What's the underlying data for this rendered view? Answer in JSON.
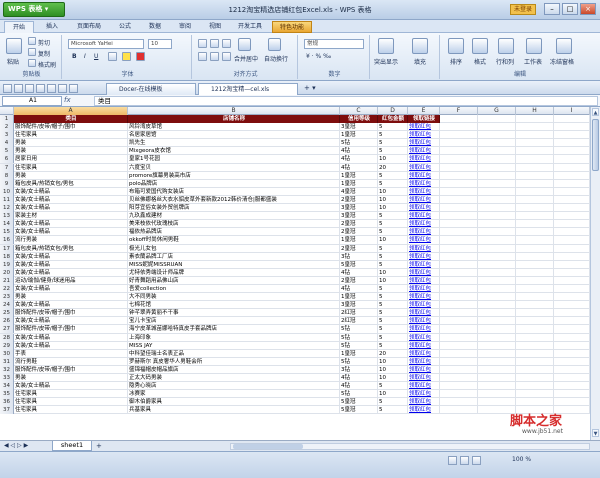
{
  "app": {
    "brand": "WPS 表格",
    "window_title": "1212淘宝精选店铺红包Excel.xls - WPS 表格",
    "unregistered": "未登录"
  },
  "menu_tabs": [
    "开始",
    "插入",
    "页面布局",
    "公式",
    "数据",
    "审阅",
    "视图",
    "开发工具",
    "特色功能"
  ],
  "ribbon": {
    "paste": "粘贴",
    "cut": "剪切",
    "copy": "复制",
    "format_painter": "格式刷",
    "group_clipboard": "剪贴板",
    "font_name": "Microsoft YaHei",
    "font_size": "10",
    "group_font": "字体",
    "merge": "合并居中",
    "wrap": "自动换行",
    "group_align": "对齐方式",
    "number_format": "常规",
    "group_number": "数字",
    "cond_format": "突出显示",
    "fill": "填充",
    "sort": "排序",
    "format": "格式",
    "row_col": "行和列",
    "worksheet": "工作表",
    "freeze": "冻结窗格",
    "group_edit": "编辑"
  },
  "doc_tabs": [
    "Docer-在线模板",
    "1212淘宝精—cel.xls"
  ],
  "formula_bar": {
    "cell_ref": "A1",
    "fx": "fx",
    "content": "类目"
  },
  "columns": [
    "A",
    "B",
    "C",
    "D",
    "E",
    "F",
    "G",
    "H",
    "I"
  ],
  "table_header": [
    "类目",
    "店铺名称",
    "信用等级",
    "红包金额",
    "领取链接"
  ],
  "rows": [
    [
      "服饰配件/皮带/帽子/围巾",
      "风铃湾皮草馆",
      "3皇冠",
      "5",
      "领取红包"
    ],
    [
      "住宅家具",
      "名居家居馆",
      "1皇冠",
      "5",
      "领取红包"
    ],
    [
      "男装",
      "凯先生",
      "5钻",
      "5",
      "领取红包"
    ],
    [
      "男装",
      "Mixgeora皮衣馆",
      "4钻",
      "5",
      "领取红包"
    ],
    [
      "居家日用",
      "皇家1号花园",
      "4钻",
      "10",
      "领取红包"
    ],
    [
      "住宅家具",
      "六度宝贝",
      "4钻",
      "20",
      "领取红包"
    ],
    [
      "男装",
      "promore旗幕男装高市店",
      "1皇冠",
      "5",
      "领取红包"
    ],
    [
      "箱包皮具/热销女包/男包",
      "polo品牌店",
      "1皇冠",
      "5",
      "领取红包"
    ],
    [
      "女装/女士精品",
      "布箱可爱国代购女装店",
      "4皇冠",
      "10",
      "领取红包"
    ],
    [
      "女装/女士精品",
      "贝丝佛娜格丝大衣水貂皮草外套新款2012韩价清仓|服都盛装",
      "2皇冠",
      "10",
      "领取红包"
    ],
    [
      "女装/女士精品",
      "阳芽宜俗女装外贸创牌店",
      "3皇冠",
      "10",
      "领取红包"
    ],
    [
      "家装主材",
      "九玖鑫成建材",
      "3皇冠",
      "5",
      "领取红包"
    ],
    [
      "女装/女士精品",
      "美来枝依代玫瑰枝店",
      "2皇冠",
      "5",
      "领取红包"
    ],
    [
      "女装/女士精品",
      "福依热品牌店",
      "2皇冠",
      "5",
      "领取红包"
    ],
    [
      "流行男装",
      "okkoff时尚休闲男鞋",
      "1皇冠",
      "10",
      "领取红包"
    ],
    [
      "箱包皮具/热销女包/男包",
      "极光儿女包",
      "2皇冠",
      "5",
      "领取红包"
    ],
    [
      "女装/女士精品",
      "素衣蘭品牌工厂店",
      "3钻",
      "5",
      "领取红包"
    ],
    [
      "女装/女士精品",
      "MISS妮妮MISSRUAN",
      "5皇冠",
      "5",
      "领取红包"
    ],
    [
      "女装/女士精品",
      "尤特依秀端设计师品牌",
      "4钻",
      "10",
      "领取红包"
    ],
    [
      "运动/瑜伽/健身/球迷用品",
      "好青舞蹈用品佛山店",
      "2皇冠",
      "10",
      "领取红包"
    ],
    [
      "女装/女士精品",
      "吾爱collection",
      "4钻",
      "5",
      "领取红包"
    ],
    [
      "男装",
      "大不同男装",
      "1皇冠",
      "5",
      "领取红包"
    ],
    [
      "女装/女士精品",
      "七棉花馆",
      "3皇冠",
      "5",
      "领取红包"
    ],
    [
      "服饰配件/皮带/帽子/围巾",
      "钟芊翠弄黄丽不干事",
      "2红冠",
      "5",
      "领取红包"
    ],
    [
      "女装/女士精品",
      "宝儿卡宝店",
      "2红冠",
      "5",
      "领取红包"
    ],
    [
      "服饰配件/皮带/帽子/围巾",
      "海宁皮革城苗娜哈特真皮手套品牌店",
      "5钻",
      "5",
      "领取红包"
    ],
    [
      "女装/女士精品",
      "上海印象",
      "5钻",
      "5",
      "领取红包"
    ],
    [
      "女装/女士精品",
      "MISS JAY",
      "5钻",
      "5",
      "领取红包"
    ],
    [
      "手表",
      "中科望佳瑞士名表正品",
      "1皇冠",
      "20",
      "领取红包"
    ],
    [
      "流行男鞋",
      "罗赫斯尔 真皮奢华人男鞋会所",
      "5钻",
      "10",
      "领取红包"
    ],
    [
      "服饰配件/皮带/帽子/围巾",
      "盛锦福帽皮帽品旗店",
      "3钻",
      "10",
      "领取红包"
    ],
    [
      "男装",
      "正太大码男装",
      "4钻",
      "10",
      "领取红包"
    ],
    [
      "女装/女士精品",
      "隐秀心晓店",
      "4钻",
      "5",
      "领取红包"
    ],
    [
      "住宅家具",
      "冰赛家",
      "5钻",
      "10",
      "领取红包"
    ],
    [
      "住宅家具",
      "御木伯爵家具",
      "5皇冠",
      "5",
      "领取红包"
    ],
    [
      "住宅家具",
      "兵基家具",
      "5皇冠",
      "5",
      "领取红包"
    ]
  ],
  "sheet_tab": "sheet1",
  "zoom": "100 %",
  "watermark": {
    "text": "脚本之家",
    "url": "www.jb51.net"
  }
}
